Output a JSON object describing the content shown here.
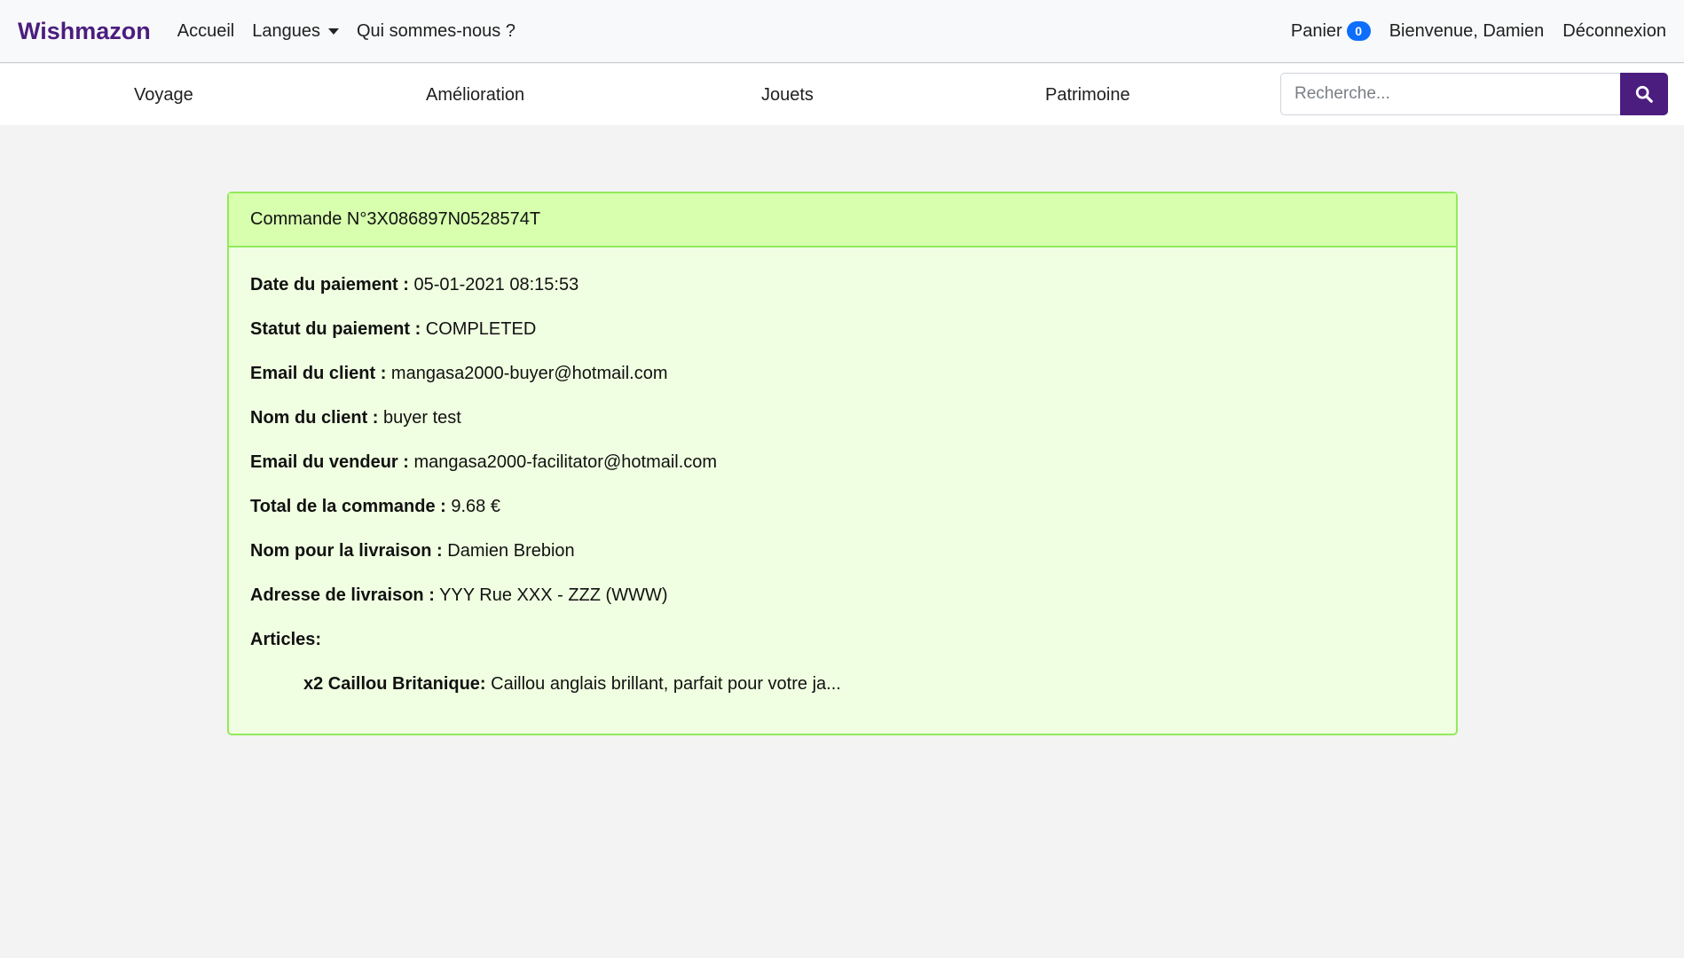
{
  "navbar": {
    "brand": "Wishmazon",
    "links": {
      "home": "Accueil",
      "languages": "Langues",
      "about": "Qui sommes-nous ?"
    },
    "cart_label": "Panier",
    "cart_count": "0",
    "welcome": "Bienvenue, Damien",
    "logout": "Déconnexion"
  },
  "categories": [
    "Voyage",
    "Amélioration",
    "Jouets",
    "Patrimoine"
  ],
  "search": {
    "placeholder": "Recherche...",
    "value": ""
  },
  "order": {
    "header": "Commande N°3X086897N0528574T",
    "fields": [
      {
        "label": "Date du paiement :",
        "value": "05-01-2021 08:15:53"
      },
      {
        "label": "Statut du paiement :",
        "value": "COMPLETED"
      },
      {
        "label": "Email du client :",
        "value": "mangasa2000-buyer@hotmail.com"
      },
      {
        "label": "Nom du client :",
        "value": "buyer test"
      },
      {
        "label": "Email du vendeur :",
        "value": "mangasa2000-facilitator@hotmail.com"
      },
      {
        "label": "Total de la commande :",
        "value": "9.68 €"
      },
      {
        "label": "Nom pour la livraison :",
        "value": "Damien Brebion"
      },
      {
        "label": "Adresse de livraison :",
        "value": "YYY Rue XXX - ZZZ (WWW)"
      }
    ],
    "articles_label": "Articles:",
    "articles": [
      {
        "name": "x2 Caillou Britanique:",
        "description": "Caillou anglais brillant, parfait pour votre ja..."
      }
    ]
  },
  "colors": {
    "brand": "#4b1d7f",
    "badge": "#0d6efd",
    "card_header_bg": "#d7ffae",
    "card_bg": "#f0ffe1",
    "card_border": "#93ea5c"
  },
  "icons": {
    "search": "search-icon",
    "dropdown": "chevron-down-icon"
  }
}
